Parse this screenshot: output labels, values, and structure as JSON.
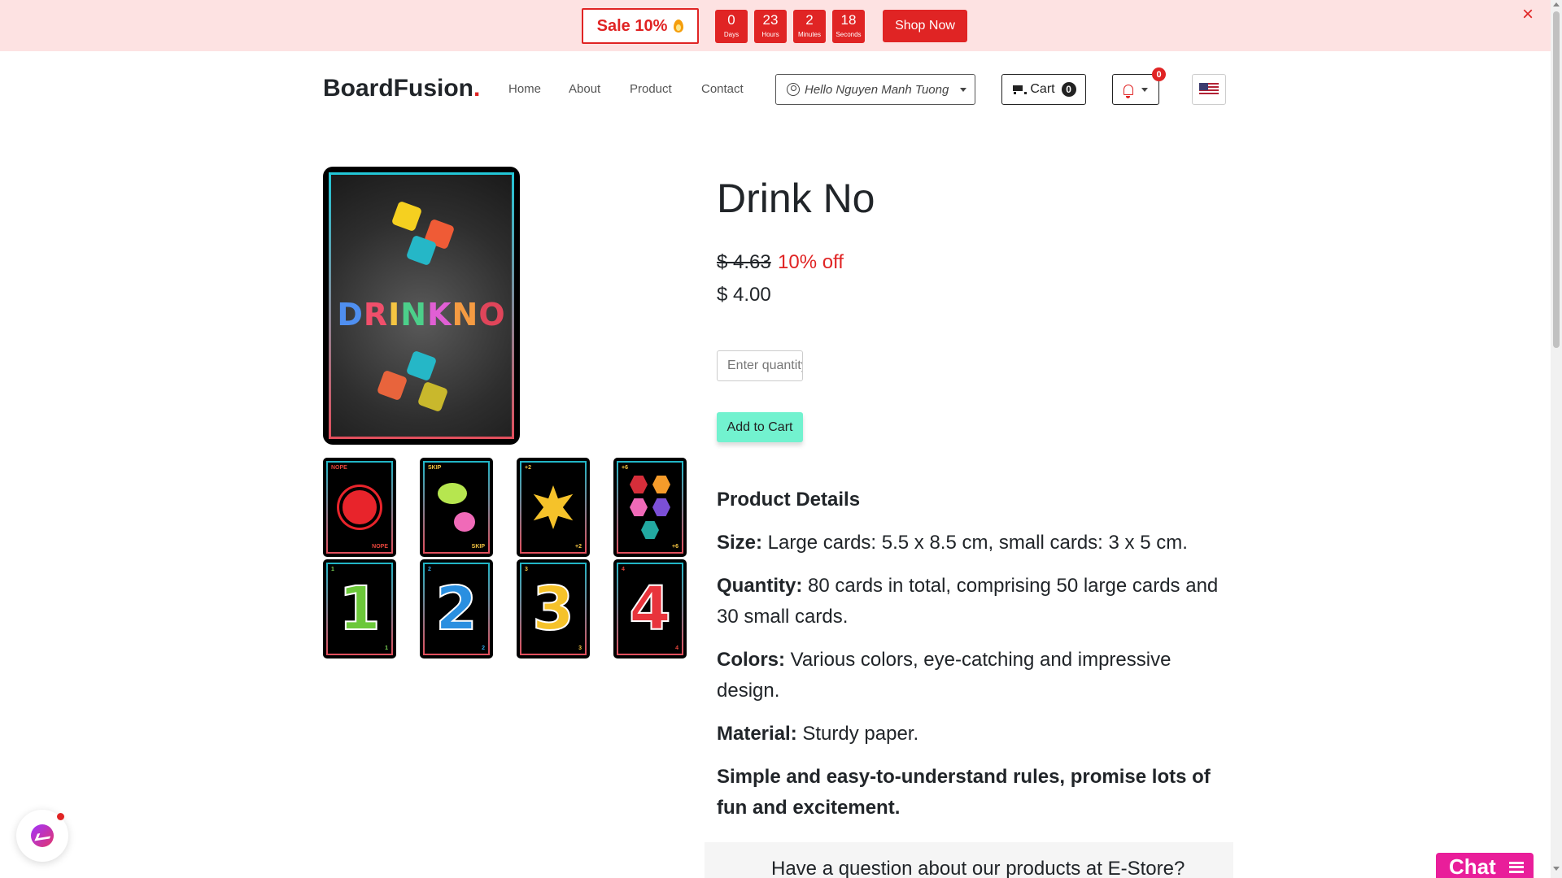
{
  "promo": {
    "sale_label": "Sale 10%",
    "countdown": [
      {
        "value": "0",
        "unit": "Days"
      },
      {
        "value": "23",
        "unit": "Hours"
      },
      {
        "value": "2",
        "unit": "Minutes"
      },
      {
        "value": "18",
        "unit": "Seconds"
      }
    ],
    "shop_label": "Shop Now",
    "close_glyph": "×"
  },
  "nav": {
    "brand": "BoardFusion",
    "brand_dot": ".",
    "links": [
      "Home",
      "About",
      "Product",
      "Contact"
    ],
    "user_greeting": "Hello Nguyen Manh Tuong",
    "cart_label": "Cart",
    "cart_count": "0",
    "notification_count": "0"
  },
  "product": {
    "cover_title": "DRINKNO",
    "thumbnails": [
      {
        "tag": "NOPE",
        "icon": "nope-card-icon"
      },
      {
        "tag": "SKIP",
        "icon": "skip-card-icon"
      },
      {
        "tag": "+2",
        "icon": "plus-two-card-icon"
      },
      {
        "tag": "+6",
        "icon": "plus-six-card-icon"
      },
      {
        "tag": "1",
        "icon": "number-one-card-icon"
      },
      {
        "tag": "2",
        "icon": "number-two-card-icon"
      },
      {
        "tag": "3",
        "icon": "number-three-card-icon"
      },
      {
        "tag": "4",
        "icon": "number-four-card-icon"
      }
    ],
    "title": "Drink No",
    "old_price": "$ 4.63",
    "discount": "10% off",
    "price": "$ 4.00",
    "qty_placeholder": "Enter quantity",
    "add_to_cart": "Add to Cart",
    "details_heading": "Product Details",
    "details": [
      {
        "label": "Size:",
        "text": " Large cards: 5.5 x 8.5 cm, small cards: 3 x 5 cm."
      },
      {
        "label": "Quantity:",
        "text": " 80 cards in total, comprising 50 large cards and 30 small cards."
      },
      {
        "label": "Colors:",
        "text": " Various colors, eye-catching and impressive design."
      },
      {
        "label": "Material:",
        "text": " Sturdy paper."
      }
    ],
    "tagline": "Simple and easy-to-understand rules, promise lots of fun and excitement."
  },
  "question_text": "Have a question about our products at E-Store?",
  "chat_label": "Chat",
  "colors": {
    "accent_red": "#e02424",
    "promo_bg": "#fde2e2",
    "add_btn": "#72f2cf",
    "chat_pink": "#e91e9a"
  }
}
